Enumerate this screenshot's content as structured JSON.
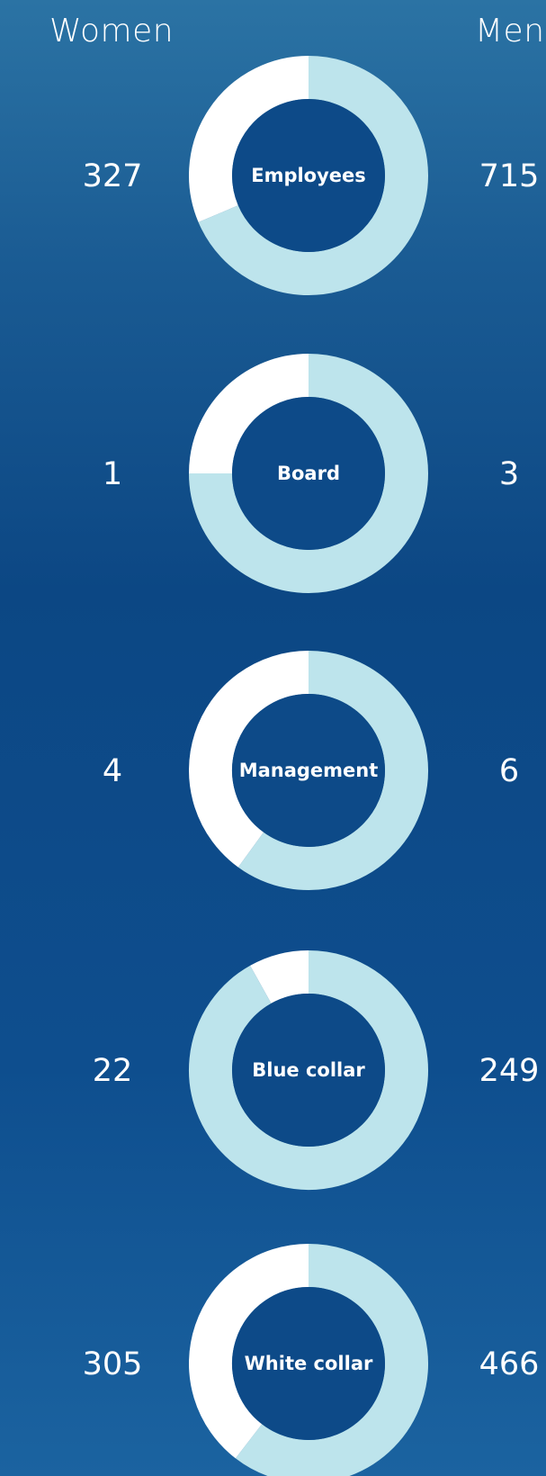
{
  "headers": {
    "women": "Women",
    "men": "Men"
  },
  "colors": {
    "women": "#ffffff",
    "men": "#bde4ec",
    "center": "#0d4a88"
  },
  "chart_data": [
    {
      "type": "pie",
      "title": "Employees",
      "series": [
        {
          "name": "Women",
          "value": 327
        },
        {
          "name": "Men",
          "value": 715
        }
      ]
    },
    {
      "type": "pie",
      "title": "Board",
      "series": [
        {
          "name": "Women",
          "value": 1
        },
        {
          "name": "Men",
          "value": 3
        }
      ]
    },
    {
      "type": "pie",
      "title": "Management",
      "series": [
        {
          "name": "Women",
          "value": 4
        },
        {
          "name": "Men",
          "value": 6
        }
      ]
    },
    {
      "type": "pie",
      "title": "Blue collar",
      "series": [
        {
          "name": "Women",
          "value": 22
        },
        {
          "name": "Men",
          "value": 249
        }
      ]
    },
    {
      "type": "pie",
      "title": "White collar",
      "series": [
        {
          "name": "Women",
          "value": 305
        },
        {
          "name": "Men",
          "value": 466
        }
      ]
    }
  ]
}
